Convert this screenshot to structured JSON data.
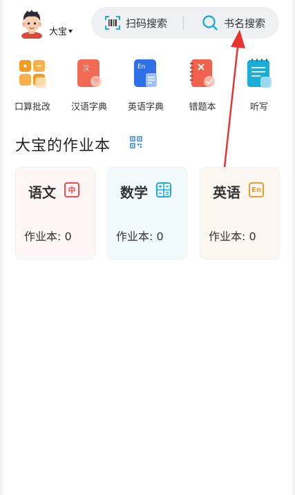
{
  "user": {
    "name": "大宝"
  },
  "search": {
    "scan_label": "扫码搜索",
    "name_label": "书名搜索"
  },
  "tools": [
    {
      "label": "口算批改",
      "icon": "calculator-grid-icon"
    },
    {
      "label": "汉语字典",
      "icon": "chinese-dictionary-icon"
    },
    {
      "label": "英语字典",
      "icon": "english-dictionary-icon"
    },
    {
      "label": "错题本",
      "icon": "mistake-notebook-icon"
    },
    {
      "label": "听写",
      "icon": "dictation-notepad-icon"
    }
  ],
  "section": {
    "title": "大宝的作业本"
  },
  "subjects": [
    {
      "name": "语文",
      "badge": "中",
      "count_label": "作业本: 0",
      "color": "#f24949",
      "bg": "#fff6f5"
    },
    {
      "name": "数学",
      "badge": "",
      "count_label": "作业本: 0",
      "color": "#1aaed6",
      "bg": "#f1fbfd"
    },
    {
      "name": "英语",
      "badge": "En",
      "count_label": "作业本: 0",
      "color": "#f59a23",
      "bg": "#fdf7f2"
    }
  ],
  "colors": {
    "annotation_arrow": "#e8342f",
    "qr_icon": "#3a8ef6"
  }
}
